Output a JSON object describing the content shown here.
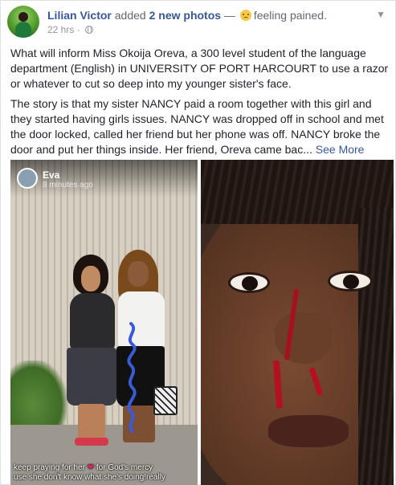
{
  "post": {
    "author": "Lilian Victor",
    "action_text": " added ",
    "photos_link": "2 new photos",
    "dash": " — ",
    "feeling": "feeling pained.",
    "timestamp": "22 hrs",
    "dot": " · ",
    "menu_icon": "chevron-down-icon",
    "paragraphs": [
      "What will inform Miss Okoija Oreva, a 300 level student of the language department (English) in UNIVERSITY OF PORT HARCOURT to use a razor or whatever to cut so deep into my younger sister's face.",
      "The story is that my sister NANCY paid a room together with this girl and they started having girls issues. NANCY was dropped off in school and met the door locked, called her friend but her phone was off. NANCY broke the door and put her things inside. Her friend, Oreva came bac..."
    ],
    "see_more": "See More"
  },
  "photo1": {
    "story_name": "Eva",
    "story_time": "8 minutes ago",
    "caption_line1_a": "keep praying for her ",
    "caption_heart": "❤",
    "caption_line1_b": " for God's mercy",
    "caption_line2": "use she don't know what she's doing!really"
  },
  "colors": {
    "link": "#365899",
    "meta": "#90949c",
    "text": "#1d2129",
    "border": "#dddfe2"
  }
}
